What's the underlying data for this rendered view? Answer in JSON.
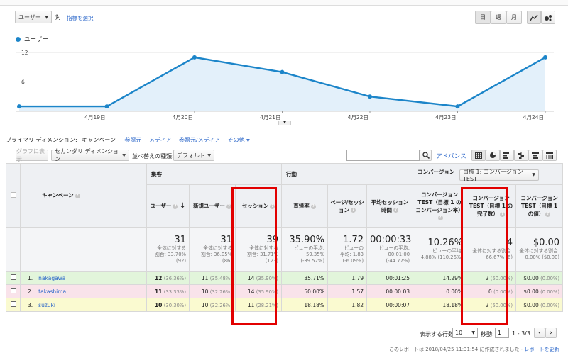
{
  "header": {
    "metric_select": "ユーザー",
    "vs_label": "対",
    "select_metric_link": "指標を選択",
    "period_buttons": [
      "日",
      "週",
      "月"
    ]
  },
  "chart_data": {
    "type": "area",
    "legend": "ユーザー",
    "x_labels": [
      "4月19日",
      "4月20日",
      "4月21日",
      "4月22日",
      "4月23日",
      "4月24日"
    ],
    "y_ticks": [
      "12",
      "6"
    ],
    "ylim": [
      0,
      12
    ],
    "values": [
      1,
      1,
      11,
      8,
      3,
      1,
      11
    ],
    "color": "#1c85c9"
  },
  "dimension_bar": {
    "label": "プライマリ ディメンション:",
    "active": "キャンペーン",
    "links": [
      "参照元",
      "メディア",
      "参照元/メディア",
      "その他"
    ]
  },
  "toolbar": {
    "plot_rows": "グラフに表示",
    "secondary_dimension": "セカンダリ ディメンション",
    "sort_label": "並べ替えの種類:",
    "sort_value": "デフォルト",
    "search_placeholder": "",
    "advanced": "アドバンス"
  },
  "table": {
    "groups": {
      "acquisition": "集客",
      "behavior": "行動",
      "conversion": "コンバージョン",
      "goal_select": "目標 1: コンバージョンTEST"
    },
    "headers": [
      "キャンペーン",
      "ユーザー",
      "新規ユーザー",
      "セッション",
      "直帰率",
      "ページ/セッション",
      "平均セッション時間",
      "コンバージョンTEST（目標 1 のコンバージョン率）",
      "コンバージョンTEST（目標 1 の完了数）",
      "コンバージョンTEST（目標 1 の値）"
    ],
    "totals": [
      {
        "big": "31",
        "sm1": "全体に対する",
        "sm2": "割合: 33.70%",
        "sm3": "(92)"
      },
      {
        "big": "31",
        "sm1": "全体に対する",
        "sm2": "割合: 36.05%",
        "sm3": "(86)"
      },
      {
        "big": "39",
        "sm1": "全体に対する",
        "sm2": "割合: 31.71%",
        "sm3": "(123)"
      },
      {
        "big": "35.90%",
        "sm1": "ビューの平均:",
        "sm2": "59.35%",
        "sm3": "(-39.52%)"
      },
      {
        "big": "1.72",
        "sm1": "ビューの",
        "sm2": "平均: 1.83",
        "sm3": "(-6.09%)"
      },
      {
        "big": "00:00:33",
        "sm1": "ビューの平均:",
        "sm2": "00:01:00",
        "sm3": "(-44.77%)"
      },
      {
        "big": "10.26%",
        "sm1": "ビューの平均:",
        "sm2": "4.88% (110.26%)",
        "sm3": ""
      },
      {
        "big": "4",
        "sm1": "全体に対する割合:",
        "sm2": "66.67% (6)",
        "sm3": ""
      },
      {
        "big": "$0.00",
        "sm1": "全体に対する割合:",
        "sm2": "0.00% ($0.00)",
        "sm3": ""
      }
    ],
    "rows": [
      {
        "num": "1.",
        "name": "nakagawa",
        "users": "12",
        "users_pct": "(36.36%)",
        "new": "11",
        "new_pct": "(35.48%)",
        "sessions": "14",
        "sessions_pct": "(35.90%)",
        "bounce": "35.71%",
        "pps": "1.79",
        "dur": "00:01:25",
        "cr": "14.29%",
        "comp": "2",
        "comp_pct": "(50.00%)",
        "val": "$0.00",
        "val_pct": "(0.00%)"
      },
      {
        "num": "2.",
        "name": "takashima",
        "users": "11",
        "users_pct": "(33.33%)",
        "new": "10",
        "new_pct": "(32.26%)",
        "sessions": "14",
        "sessions_pct": "(35.90%)",
        "bounce": "50.00%",
        "pps": "1.57",
        "dur": "00:00:03",
        "cr": "0.00%",
        "comp": "0",
        "comp_pct": "(0.00%)",
        "val": "$0.00",
        "val_pct": "(0.00%)"
      },
      {
        "num": "3.",
        "name": "suzuki",
        "users": "10",
        "users_pct": "(30.30%)",
        "new": "10",
        "new_pct": "(32.26%)",
        "sessions": "11",
        "sessions_pct": "(28.21%)",
        "bounce": "18.18%",
        "pps": "1.82",
        "dur": "00:00:07",
        "cr": "18.18%",
        "comp": "2",
        "comp_pct": "(50.00%)",
        "val": "$0.00",
        "val_pct": "(0.00%)"
      }
    ]
  },
  "footer": {
    "rows_label": "表示する行数:",
    "rows_value": "10",
    "goto_label": "移動:",
    "goto_value": "1",
    "range": "1 - 3/3",
    "created": "このレポートは 2018/04/25 11:31:54 に作成されました -",
    "refresh": "レポートを更新"
  }
}
